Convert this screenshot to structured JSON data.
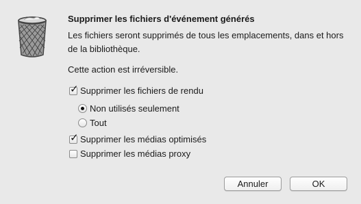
{
  "dialog": {
    "title": "Supprimer les fichiers d'événement générés",
    "message": "Les fichiers seront supprimés de tous les emplacements, dans et hors de la bibliothèque.",
    "warning": "Cette action est irréversible.",
    "icon": "trash-icon"
  },
  "options": {
    "render_files": {
      "label": "Supprimer les fichiers de rendu",
      "checked": true
    },
    "unused_only": {
      "label": "Non utilisés seulement",
      "selected": true
    },
    "all": {
      "label": "Tout",
      "selected": false
    },
    "optimized_media": {
      "label": "Supprimer les médias optimisés",
      "checked": true
    },
    "proxy_media": {
      "label": "Supprimer les médias proxy",
      "checked": false
    }
  },
  "buttons": {
    "cancel": "Annuler",
    "ok": "OK"
  }
}
